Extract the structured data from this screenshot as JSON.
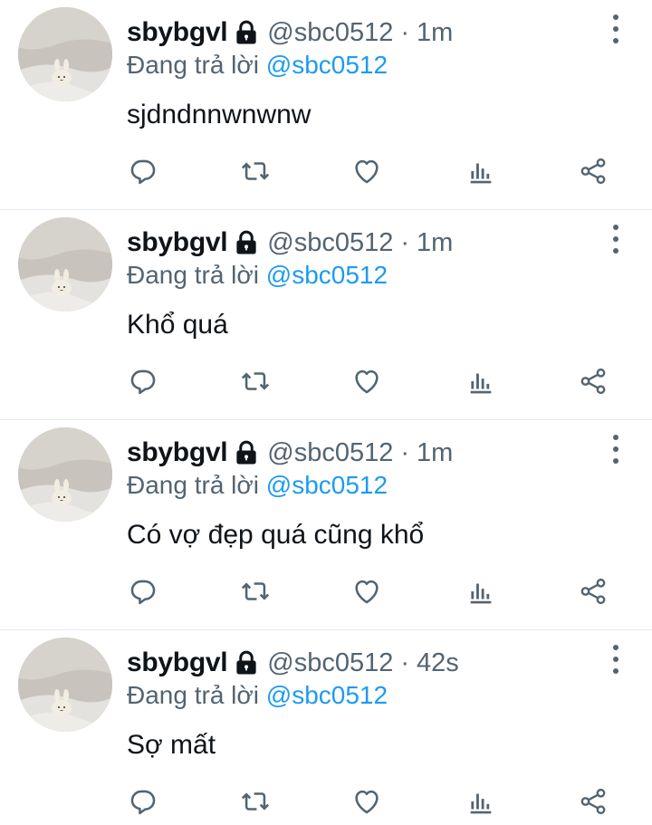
{
  "tweets": [
    {
      "name": "sbybgvl",
      "handle": "@sbc0512",
      "separator": "·",
      "time": "1m",
      "reply_prefix": "Đang trả lời",
      "reply_to": "@sbc0512",
      "text": "sjdndnnwnwnw"
    },
    {
      "name": "sbybgvl",
      "handle": "@sbc0512",
      "separator": "·",
      "time": "1m",
      "reply_prefix": "Đang trả lời",
      "reply_to": "@sbc0512",
      "text": "Khổ quá"
    },
    {
      "name": "sbybgvl",
      "handle": "@sbc0512",
      "separator": "·",
      "time": "1m",
      "reply_prefix": "Đang trả lời",
      "reply_to": "@sbc0512",
      "text": "Có vợ đẹp quá cũng khổ"
    },
    {
      "name": "sbybgvl",
      "handle": "@sbc0512",
      "separator": "·",
      "time": "42s",
      "reply_prefix": "Đang trả lời",
      "reply_to": "@sbc0512",
      "text": "Sợ mất"
    }
  ],
  "icons": {
    "lock": "lock-icon",
    "more": "more-vertical-icon",
    "reply": "reply-icon",
    "retweet": "retweet-icon",
    "like": "heart-icon",
    "views": "views-icon",
    "share": "share-icon"
  },
  "colors": {
    "text": "#0f1419",
    "secondary": "#536471",
    "link": "#1d9bf0",
    "divider": "#e6e9ec"
  }
}
